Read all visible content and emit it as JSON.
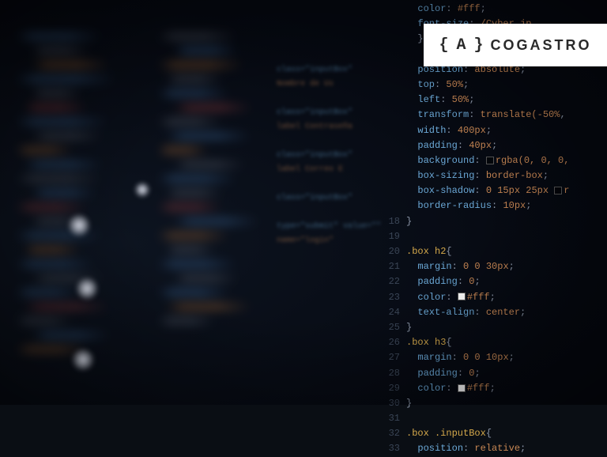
{
  "badge": {
    "icon_glyph": "{ A }",
    "text": "COGASTRO"
  },
  "middle": [
    {
      "cls": "kw-prop",
      "t": "class=\"inputBox\""
    },
    {
      "cls": "kw-val",
      "t": "  Nombre de Us"
    },
    {
      "cls": "kw-prop",
      "t": ""
    },
    {
      "cls": "kw-prop",
      "t": "class=\"inputBox\""
    },
    {
      "cls": "kw-val",
      "t": "  label Contraseña"
    },
    {
      "cls": "kw-prop",
      "t": ""
    },
    {
      "cls": "kw-prop",
      "t": "class=\"inputBox\""
    },
    {
      "cls": "kw-val",
      "t": "  label Correo E"
    },
    {
      "cls": "kw-prop",
      "t": ""
    },
    {
      "cls": "kw-prop",
      "t": "class=\"inputBox\""
    },
    {
      "cls": "kw-prop",
      "t": ""
    },
    {
      "cls": "kw-prop",
      "t": "  type=\"submit\" value=\"\""
    },
    {
      "cls": "kw-val",
      "t": "  name=\"login\""
    }
  ],
  "sharp": [
    {
      "n": "",
      "i": 1,
      "t": [
        {
          "c": "kw-prop",
          "s": "color"
        },
        {
          "c": "kw-punc",
          "s": ": "
        },
        {
          "c": "kw-val",
          "s": "#fff"
        },
        {
          "c": "kw-punc",
          "s": ";"
        }
      ]
    },
    {
      "n": "",
      "i": 1,
      "t": [
        {
          "c": "kw-prop",
          "s": "font-size"
        },
        {
          "c": "kw-punc",
          "s": ": "
        },
        {
          "c": "kw-val",
          "s": "/Cyber.jp"
        }
      ]
    },
    {
      "n": "",
      "i": 1,
      "t": [
        {
          "c": "kw-punc",
          "s": "}"
        }
      ]
    },
    {
      "n": "",
      "i": 1,
      "t": []
    },
    {
      "n": "",
      "i": 1,
      "t": [
        {
          "c": "kw-prop",
          "s": "position"
        },
        {
          "c": "kw-punc",
          "s": ": "
        },
        {
          "c": "kw-val",
          "s": "absolute"
        },
        {
          "c": "kw-punc",
          "s": ";"
        }
      ]
    },
    {
      "n": "",
      "i": 1,
      "t": [
        {
          "c": "kw-prop",
          "s": "top"
        },
        {
          "c": "kw-punc",
          "s": ": "
        },
        {
          "c": "kw-val",
          "s": "50%"
        },
        {
          "c": "kw-punc",
          "s": ";"
        }
      ]
    },
    {
      "n": "",
      "i": 1,
      "t": [
        {
          "c": "kw-prop",
          "s": "left"
        },
        {
          "c": "kw-punc",
          "s": ": "
        },
        {
          "c": "kw-val",
          "s": "50%"
        },
        {
          "c": "kw-punc",
          "s": ";"
        }
      ]
    },
    {
      "n": "",
      "i": 1,
      "t": [
        {
          "c": "kw-prop",
          "s": "transform"
        },
        {
          "c": "kw-punc",
          "s": ": "
        },
        {
          "c": "kw-val",
          "s": "translate(-50%"
        },
        {
          "c": "kw-punc",
          "s": ","
        }
      ]
    },
    {
      "n": "",
      "i": 1,
      "t": [
        {
          "c": "kw-prop",
          "s": "width"
        },
        {
          "c": "kw-punc",
          "s": ": "
        },
        {
          "c": "kw-val",
          "s": "400px"
        },
        {
          "c": "kw-punc",
          "s": ";"
        }
      ]
    },
    {
      "n": "",
      "i": 1,
      "t": [
        {
          "c": "kw-prop",
          "s": "padding"
        },
        {
          "c": "kw-punc",
          "s": ": "
        },
        {
          "c": "kw-val",
          "s": "40px"
        },
        {
          "c": "kw-punc",
          "s": ";"
        }
      ]
    },
    {
      "n": "",
      "i": 1,
      "t": [
        {
          "c": "kw-prop",
          "s": "background"
        },
        {
          "c": "kw-punc",
          "s": ": "
        },
        {
          "c": "swatch sw-rgba",
          "s": ""
        },
        {
          "c": "kw-val",
          "s": "rgba(0, 0, 0,"
        }
      ]
    },
    {
      "n": "",
      "i": 1,
      "t": [
        {
          "c": "kw-prop",
          "s": "box-sizing"
        },
        {
          "c": "kw-punc",
          "s": ": "
        },
        {
          "c": "kw-val",
          "s": "border-box"
        },
        {
          "c": "kw-punc",
          "s": ";"
        }
      ]
    },
    {
      "n": "",
      "i": 1,
      "t": [
        {
          "c": "kw-prop",
          "s": "box-shadow"
        },
        {
          "c": "kw-punc",
          "s": ": "
        },
        {
          "c": "kw-val",
          "s": "0 15px 25px "
        },
        {
          "c": "swatch sw-rgba",
          "s": ""
        },
        {
          "c": "kw-val",
          "s": "r"
        }
      ]
    },
    {
      "n": "",
      "i": 1,
      "t": [
        {
          "c": "kw-prop",
          "s": "border-radius"
        },
        {
          "c": "kw-punc",
          "s": ": "
        },
        {
          "c": "kw-val",
          "s": "10px"
        },
        {
          "c": "kw-punc",
          "s": ";"
        }
      ]
    },
    {
      "n": "18",
      "i": 0,
      "t": [
        {
          "c": "kw-punc",
          "s": "}"
        }
      ]
    },
    {
      "n": "19",
      "i": 0,
      "t": []
    },
    {
      "n": "20",
      "i": 0,
      "t": [
        {
          "c": "kw-sel",
          "s": ".box h2"
        },
        {
          "c": "kw-punc",
          "s": "{"
        }
      ]
    },
    {
      "n": "21",
      "i": 1,
      "t": [
        {
          "c": "kw-prop",
          "s": "margin"
        },
        {
          "c": "kw-punc",
          "s": ": "
        },
        {
          "c": "kw-val",
          "s": "0 0 30px"
        },
        {
          "c": "kw-punc",
          "s": ";"
        }
      ]
    },
    {
      "n": "22",
      "i": 1,
      "t": [
        {
          "c": "kw-prop",
          "s": "padding"
        },
        {
          "c": "kw-punc",
          "s": ": "
        },
        {
          "c": "kw-val",
          "s": "0"
        },
        {
          "c": "kw-punc",
          "s": ";"
        }
      ]
    },
    {
      "n": "23",
      "i": 1,
      "t": [
        {
          "c": "kw-prop",
          "s": "color"
        },
        {
          "c": "kw-punc",
          "s": ": "
        },
        {
          "c": "swatch sw-white",
          "s": ""
        },
        {
          "c": "kw-val",
          "s": "#fff"
        },
        {
          "c": "kw-punc",
          "s": ";"
        }
      ]
    },
    {
      "n": "24",
      "i": 1,
      "t": [
        {
          "c": "kw-prop",
          "s": "text-align"
        },
        {
          "c": "kw-punc",
          "s": ": "
        },
        {
          "c": "kw-val",
          "s": "center"
        },
        {
          "c": "kw-punc",
          "s": ";"
        }
      ]
    },
    {
      "n": "25",
      "i": 0,
      "t": [
        {
          "c": "kw-punc",
          "s": "}"
        }
      ]
    },
    {
      "n": "26",
      "i": 0,
      "t": [
        {
          "c": "kw-sel",
          "s": ".box h3"
        },
        {
          "c": "kw-punc",
          "s": "{"
        }
      ]
    },
    {
      "n": "27",
      "i": 1,
      "t": [
        {
          "c": "kw-prop",
          "s": "margin"
        },
        {
          "c": "kw-punc",
          "s": ": "
        },
        {
          "c": "kw-val",
          "s": "0 0 10px"
        },
        {
          "c": "kw-punc",
          "s": ";"
        }
      ]
    },
    {
      "n": "28",
      "i": 1,
      "t": [
        {
          "c": "kw-prop",
          "s": "padding"
        },
        {
          "c": "kw-punc",
          "s": ": "
        },
        {
          "c": "kw-val",
          "s": "0"
        },
        {
          "c": "kw-punc",
          "s": ";"
        }
      ]
    },
    {
      "n": "29",
      "i": 1,
      "t": [
        {
          "c": "kw-prop",
          "s": "color"
        },
        {
          "c": "kw-punc",
          "s": ": "
        },
        {
          "c": "swatch sw-white",
          "s": ""
        },
        {
          "c": "kw-val",
          "s": "#fff"
        },
        {
          "c": "kw-punc",
          "s": ";"
        }
      ]
    },
    {
      "n": "30",
      "i": 0,
      "t": [
        {
          "c": "kw-punc",
          "s": "}"
        }
      ]
    },
    {
      "n": "31",
      "i": 0,
      "t": []
    },
    {
      "n": "32",
      "i": 0,
      "t": [
        {
          "c": "kw-sel",
          "s": ".box .inputBox"
        },
        {
          "c": "kw-punc",
          "s": "{"
        }
      ]
    },
    {
      "n": "33",
      "i": 1,
      "t": [
        {
          "c": "kw-prop",
          "s": "position"
        },
        {
          "c": "kw-punc",
          "s": ": "
        },
        {
          "c": "kw-val",
          "s": "relative"
        },
        {
          "c": "kw-punc",
          "s": ";"
        }
      ]
    }
  ]
}
